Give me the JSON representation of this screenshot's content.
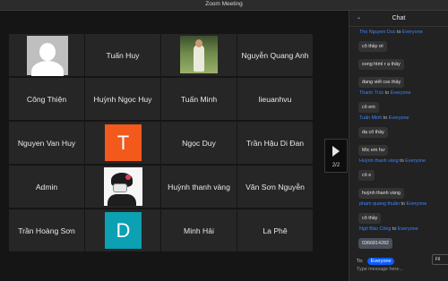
{
  "window": {
    "title": "Zoom Meeting"
  },
  "participants": [
    {
      "name": "",
      "avatar": "generic"
    },
    {
      "name": "Tuấn Huy",
      "avatar": "none"
    },
    {
      "name": "",
      "avatar": "photo"
    },
    {
      "name": "Nguyễn Quang Anh",
      "avatar": "none"
    },
    {
      "name": "Công Thiện",
      "avatar": "none"
    },
    {
      "name": "Huỳnh Ngọc Huy",
      "avatar": "none"
    },
    {
      "name": "Tuấn Minh",
      "avatar": "none"
    },
    {
      "name": "lieuanhvu",
      "avatar": "none"
    },
    {
      "name": "Nguyen Van Huy",
      "avatar": "none"
    },
    {
      "name": "",
      "avatar": "letter",
      "letter": "T",
      "color": "#f2591b"
    },
    {
      "name": "Ngọc Duy",
      "avatar": "none"
    },
    {
      "name": "Trần Hậu Di Đan",
      "avatar": "none"
    },
    {
      "name": "Admin",
      "avatar": "none"
    },
    {
      "name": "",
      "avatar": "drawing"
    },
    {
      "name": "Huỳnh thanh vàng",
      "avatar": "none"
    },
    {
      "name": "Văn Sơn Nguyễn",
      "avatar": "none"
    },
    {
      "name": "Trần Hoàng Sơn",
      "avatar": "none"
    },
    {
      "name": "",
      "avatar": "letter",
      "letter": "D",
      "color": "#0ba0b2"
    },
    {
      "name": "Minh Hải",
      "avatar": "none"
    },
    {
      "name": "La Phê",
      "avatar": "none"
    }
  ],
  "pager": {
    "icon": "chevron-right-icon",
    "page": "2/2"
  },
  "chat": {
    "title": "Chat",
    "collapse_icon": "chevron-down-icon",
    "messages": [
      {
        "sender": "Thọ Nguyen Duc",
        "to": "to",
        "recipient": "Everyone",
        "lines": [
          "cô thầy ơi",
          "xong html r ạ thầy",
          "đang viết css thầy"
        ]
      },
      {
        "sender": "Thanh Trúc",
        "to": "to",
        "recipient": "Everyone",
        "lines": [
          "cô em"
        ]
      },
      {
        "sender": "Tuấn Minh",
        "to": "to",
        "recipient": "Everyone",
        "lines": [
          "dạ cô thầy",
          "Mic em hư"
        ]
      },
      {
        "sender": "Huỳnh thanh vàng",
        "to": "to",
        "recipient": "Everyone",
        "lines": [
          "cô e",
          "huỳnh thanh vàng"
        ]
      },
      {
        "sender": "phạm quang thuần",
        "to": "to",
        "recipient": "Everyone",
        "lines": [
          "cô thầy"
        ]
      },
      {
        "sender": "Ngô Bảo Công",
        "to": "to",
        "recipient": "Everyone",
        "lines": [
          "0366814282"
        ]
      }
    ],
    "to_label": "To:",
    "to_value": "Everyone",
    "file_label": "Fil",
    "input_placeholder": "Type message here..."
  }
}
